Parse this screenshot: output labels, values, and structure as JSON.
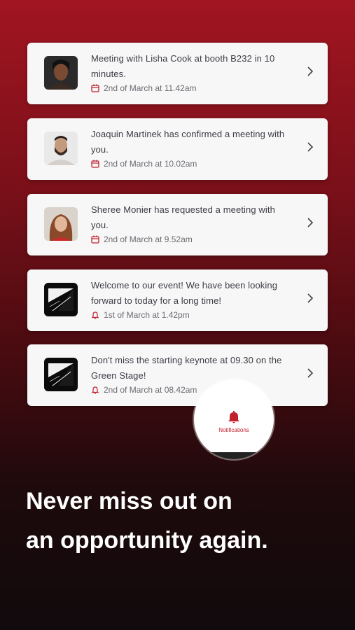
{
  "notifications": [
    {
      "message": "Meeting with Lisha Cook at booth B232 in 10 minutes.",
      "time": "2nd of March at 11.42am",
      "meta_icon": "calendar-icon",
      "avatar": "avatar-lisha"
    },
    {
      "message": "Joaquin Martinek has confirmed a meeting with you.",
      "time": "2nd of March at 10.02am",
      "meta_icon": "calendar-icon",
      "avatar": "avatar-joaquin"
    },
    {
      "message": "Sheree Monier has requested a meeting with you.",
      "time": "2nd of March at 9.52am",
      "meta_icon": "calendar-icon",
      "avatar": "avatar-sheree"
    },
    {
      "message": "Welcome to our event! We have been looking forward to today for a long time!",
      "time": "1st of March at 1.42pm",
      "meta_icon": "bell-icon",
      "avatar": "event-logo"
    },
    {
      "message": "Don't miss the starting keynote at 09.30 on the Green Stage!",
      "time": "2nd of March at 08.42am",
      "meta_icon": "bell-icon",
      "avatar": "event-logo"
    }
  ],
  "nav": {
    "notifications_label": "Notifications"
  },
  "headline": {
    "line1": "Never miss out on",
    "line2": "an opportunity again."
  },
  "colors": {
    "accent": "#c2202d",
    "card": "#f7f7f7"
  }
}
